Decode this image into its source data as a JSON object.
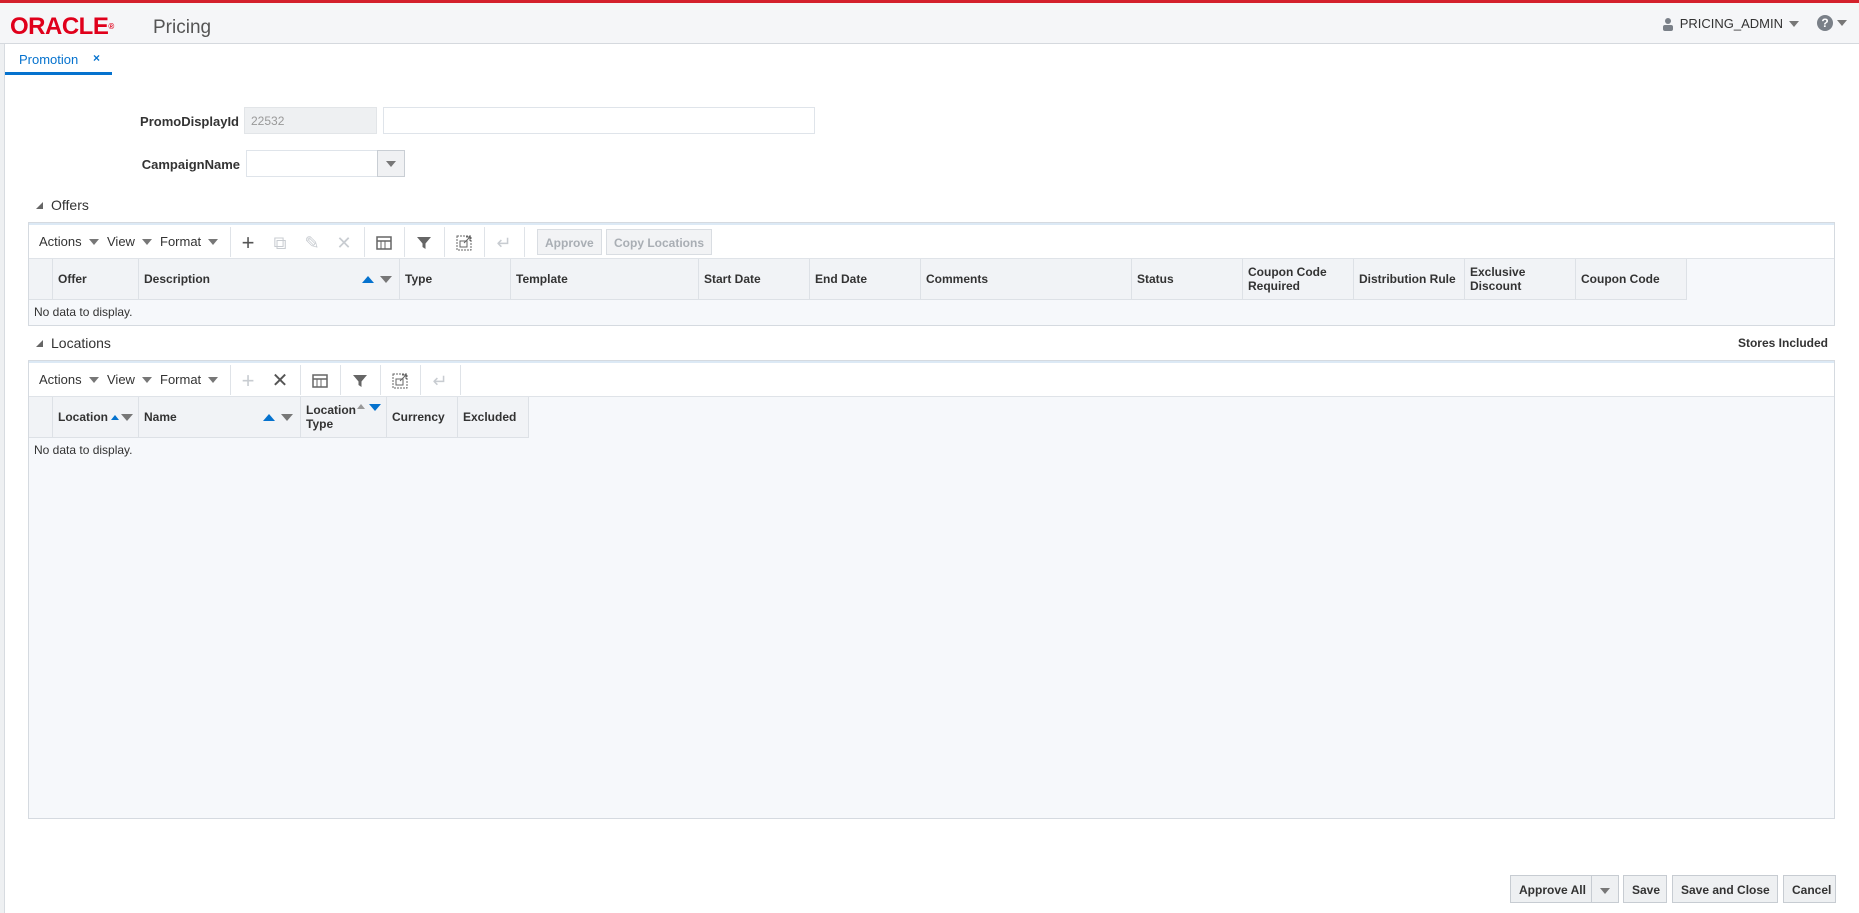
{
  "app": {
    "brand": "ORACLE",
    "name": "Pricing",
    "brand_color": "#e0001b",
    "accent": "#0572ce"
  },
  "header": {
    "user": "PRICING_ADMIN",
    "user_icon": "user-icon",
    "help_icon": "help-icon"
  },
  "tab": {
    "label": "Promotion",
    "close": "×"
  },
  "form": {
    "promo_label": "PromoDisplayId",
    "promo_value": "22532",
    "promo_desc_value": "",
    "campaign_label": "CampaignName",
    "campaign_value": ""
  },
  "offers": {
    "title": "Offers",
    "menus": [
      "Actions",
      "View",
      "Format"
    ],
    "buttons": {
      "approve": "Approve",
      "copy_locations": "Copy Locations"
    },
    "columns": [
      "Offer",
      "Description",
      "Type",
      "Template",
      "Start Date",
      "End Date",
      "Comments",
      "Status",
      "Coupon Code Required",
      "Distribution Rule",
      "Exclusive Discount",
      "Coupon Code"
    ],
    "empty": "No data to display."
  },
  "locations": {
    "title": "Locations",
    "right_label": "Stores Included",
    "menus": [
      "Actions",
      "View",
      "Format"
    ],
    "columns": [
      "Location",
      "Name",
      "Location Type",
      "Currency",
      "Excluded"
    ],
    "empty": "No data to display."
  },
  "footer": {
    "approve_all": "Approve All",
    "save": "Save",
    "save_close": "Save and Close",
    "cancel": "Cancel"
  }
}
